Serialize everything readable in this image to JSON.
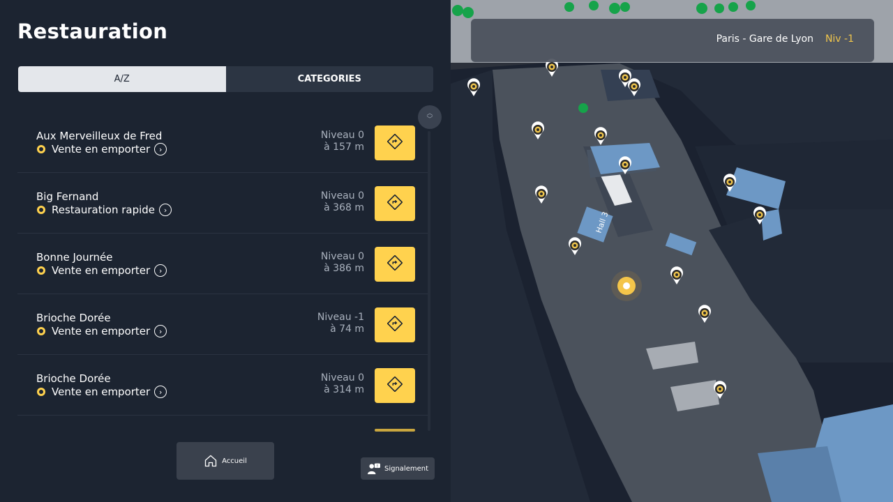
{
  "title": "Restauration",
  "tabs": [
    {
      "label": "A/Z",
      "active": true
    },
    {
      "label": "CATEGORIES",
      "active": false
    }
  ],
  "items": [
    {
      "name": "Aux Merveilleux de Fred",
      "category": "Vente en emporter",
      "level": "Niveau 0",
      "distance": "à 157 m"
    },
    {
      "name": "Big Fernand",
      "category": "Restauration rapide",
      "level": "Niveau 0",
      "distance": "à 368 m"
    },
    {
      "name": "Bonne Journée",
      "category": "Vente en emporter",
      "level": "Niveau 0",
      "distance": "à 386 m"
    },
    {
      "name": "Brioche Dorée",
      "category": "Vente en emporter",
      "level": "Niveau -1",
      "distance": "à 74 m"
    },
    {
      "name": "Brioche Dorée",
      "category": "Vente en emporter",
      "level": "Niveau 0",
      "distance": "à 314 m"
    }
  ],
  "footer": {
    "home_label": "Accueil",
    "report_label": "Signalement"
  },
  "map": {
    "station": "Paris - Gare de Lyon",
    "level": "Niv  -1",
    "hall_label": "Hall 3"
  },
  "colors": {
    "accent": "#ffd24e",
    "panel": "#1c2431",
    "level_text": "#f1c64c"
  },
  "icons": {
    "category": "restaurant-icon",
    "directions": "directions-icon",
    "home": "home-icon",
    "report": "report-icon",
    "pin": "restaurant-pin-icon"
  }
}
